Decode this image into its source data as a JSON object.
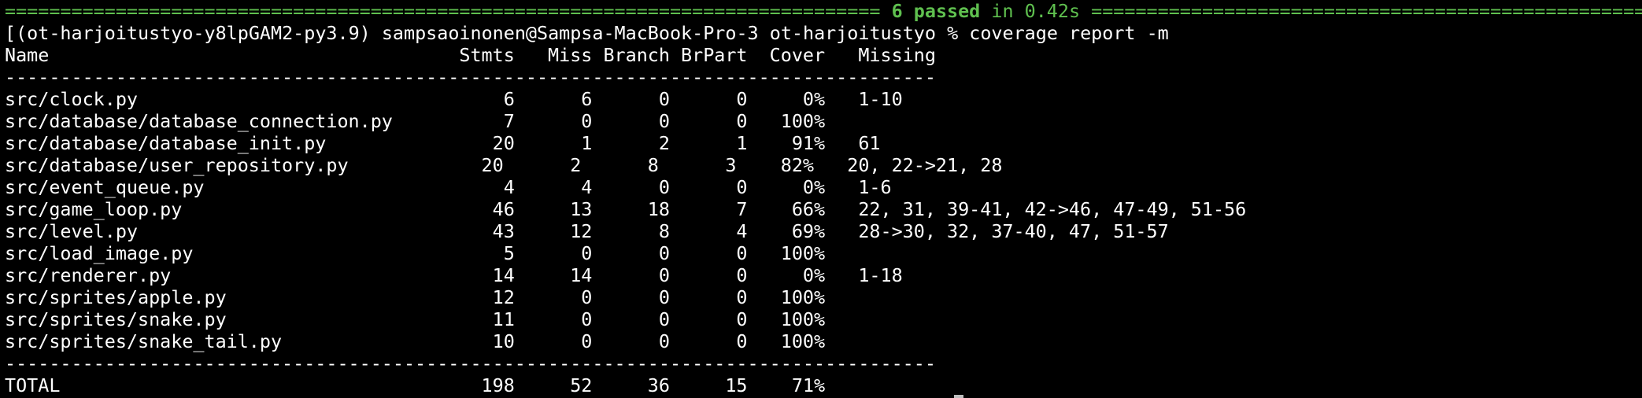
{
  "summary_line": {
    "rule_left": "===============================================================================",
    "passed_text": "6 passed",
    "time_text": "in 0.42s",
    "rule_right": "=================================================================================="
  },
  "prompt_line": {
    "leading_char": "[",
    "env": "(ot-harjoitustyo-y8lpGAM2-py3.9)",
    "user_host": "sampsaoinonen@Sampsa-MacBook-Pro-3",
    "cwd": "ot-harjoitustyo",
    "symbol": "%",
    "command": "coverage report -m"
  },
  "report": {
    "header": "Name                                     Stmts   Miss Branch BrPart  Cover   Missing",
    "separator": "------------------------------------------------------------------------------------",
    "rows": [
      "src/clock.py                                 6      6      0      0     0%   1-10",
      "src/database/database_connection.py          7      0      0      0   100%",
      "src/database/database_init.py               20      1      2      1    91%   61",
      "src/database/user_repository.py            20      2      8      3    82%   20, 22->21, 28",
      "src/event_queue.py                           4      4      0      0     0%   1-6",
      "src/game_loop.py                            46     13     18      7    66%   22, 31, 39-41, 42->46, 47-49, 51-56",
      "src/level.py                                43     12      8      4    69%   28->30, 32, 37-40, 47, 51-57",
      "src/load_image.py                            5      0      0      0   100%",
      "src/renderer.py                             14     14      0      0     0%   1-18",
      "src/sprites/apple.py                        12      0      0      0   100%",
      "src/sprites/snake.py                        11      0      0      0   100%",
      "src/sprites/snake_tail.py                   10      0      0      0   100%"
    ],
    "total": "TOTAL                                      198     52     36     15    71%"
  },
  "colors": {
    "background": "#000000",
    "text": "#ffffff",
    "pytest_green": "#5fc04f"
  }
}
